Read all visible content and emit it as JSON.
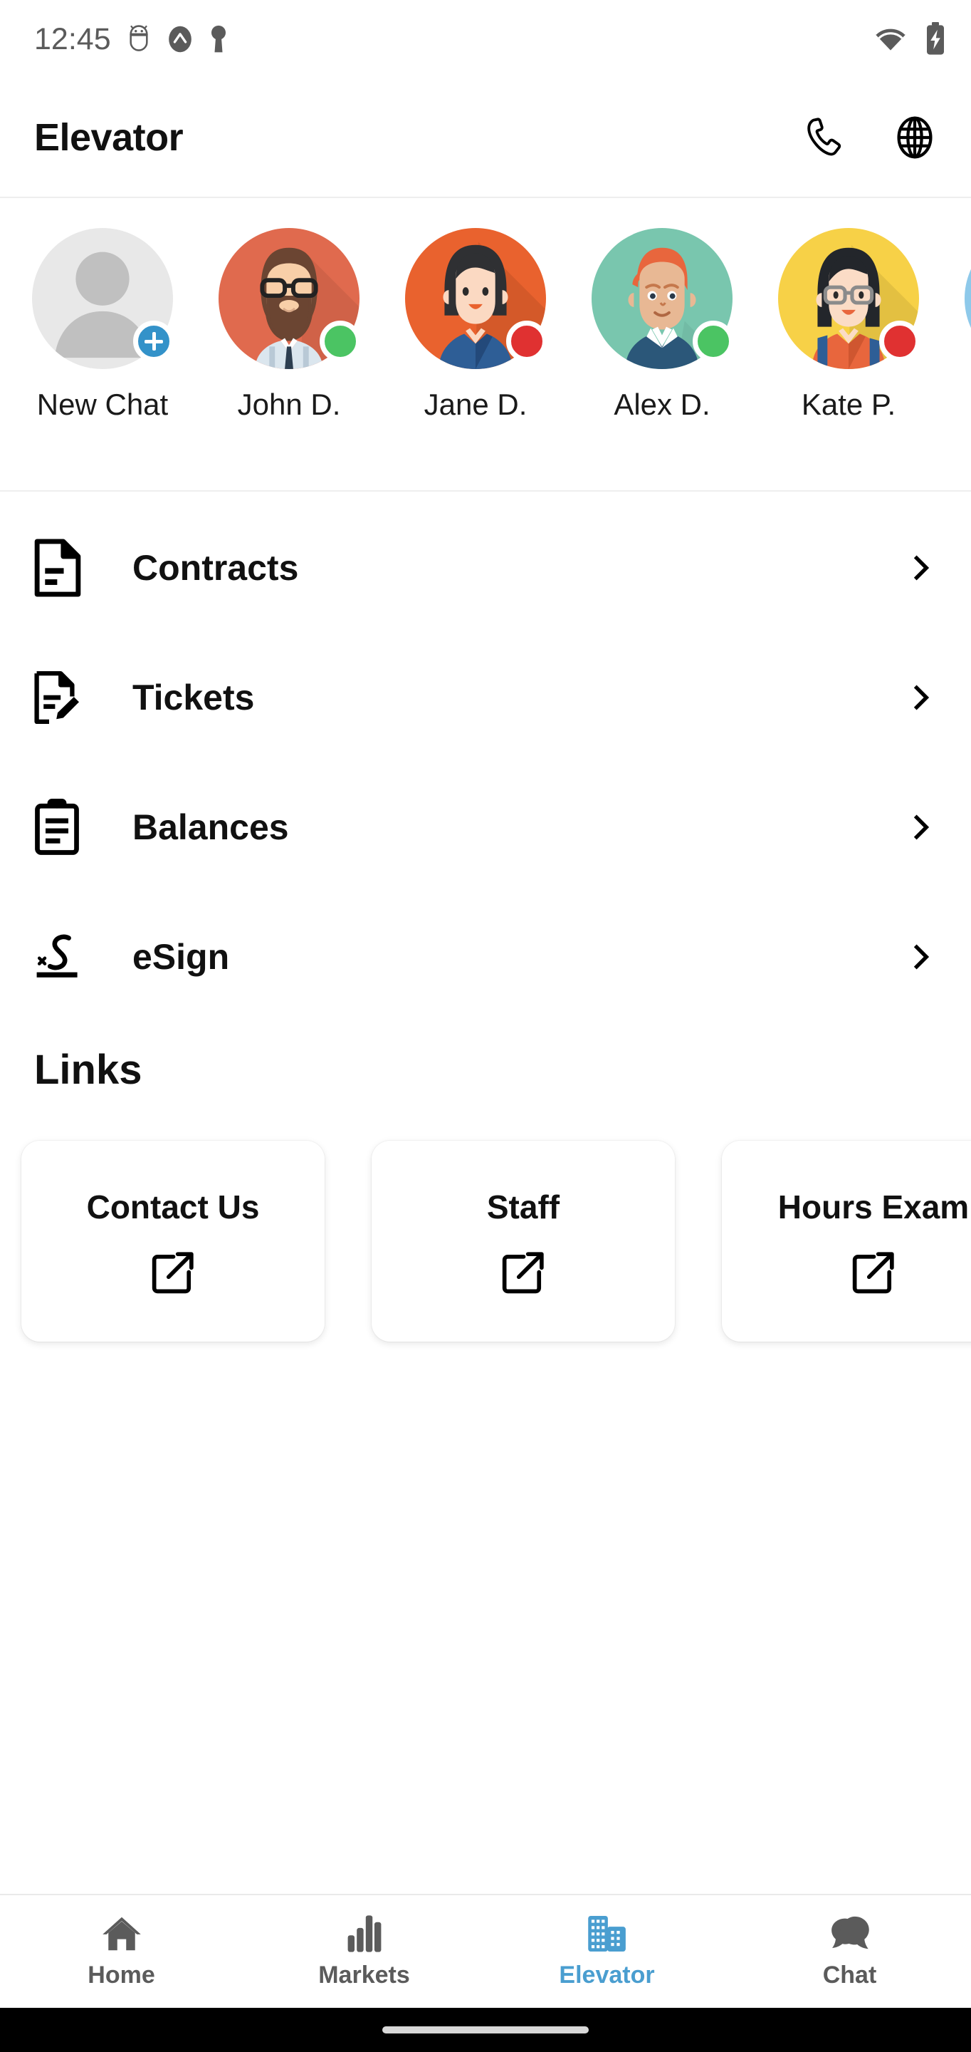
{
  "status_bar": {
    "time": "12:45",
    "left_icons": [
      "android-debug-icon",
      "app-badge-icon",
      "key-icon"
    ],
    "right_icons": [
      "wifi-icon",
      "battery-charging-icon"
    ]
  },
  "app_bar": {
    "title": "Elevator",
    "actions": [
      {
        "name": "phone-icon",
        "label": "Call"
      },
      {
        "name": "globe-icon",
        "label": "Language"
      }
    ]
  },
  "contacts": [
    {
      "name": "New Chat",
      "type": "new-chat",
      "bg": "#e8e8e8",
      "status": "add"
    },
    {
      "name": "John D.",
      "type": "avatar-bearded-man",
      "bg": "#e06a4e",
      "status": "online"
    },
    {
      "name": "Jane D.",
      "type": "avatar-dark-hair-woman",
      "bg": "#e9622e",
      "status": "busy"
    },
    {
      "name": "Alex D.",
      "type": "avatar-redhead-man",
      "bg": "#79c6ae",
      "status": "online"
    },
    {
      "name": "Kate P.",
      "type": "avatar-glasses-woman",
      "bg": "#f7d147",
      "status": "busy"
    },
    {
      "name": "",
      "type": "avatar-partial",
      "bg": "#8ec9ea",
      "status": "none"
    }
  ],
  "menu": [
    {
      "label": "Contracts",
      "icon": "document-icon",
      "chevron": "chevron-right-icon"
    },
    {
      "label": "Tickets",
      "icon": "document-edit-icon",
      "chevron": "chevron-right-icon"
    },
    {
      "label": "Balances",
      "icon": "clipboard-icon",
      "chevron": "chevron-right-icon"
    },
    {
      "label": "eSign",
      "icon": "signature-icon",
      "chevron": "chevron-right-icon"
    }
  ],
  "links_section": {
    "title": "Links",
    "cards": [
      {
        "label": "Contact Us",
        "icon": "external-link-icon"
      },
      {
        "label": "Staff",
        "icon": "external-link-icon"
      },
      {
        "label": "Hours Exam",
        "icon": "external-link-icon"
      }
    ]
  },
  "bottom_nav": {
    "active": "Elevator",
    "items": [
      {
        "label": "Home",
        "icon": "home-icon"
      },
      {
        "label": "Markets",
        "icon": "bar-chart-icon"
      },
      {
        "label": "Elevator",
        "icon": "building-icon"
      },
      {
        "label": "Chat",
        "icon": "chat-bubble-icon"
      }
    ]
  },
  "colors": {
    "accent": "#4a9ed0",
    "online": "#4bc463",
    "busy": "#e03131",
    "text": "#111111",
    "muted": "#5b5b5b"
  }
}
